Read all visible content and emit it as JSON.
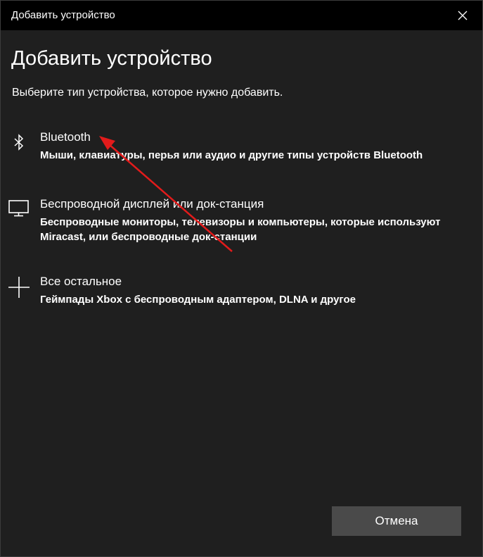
{
  "window": {
    "title": "Добавить устройство"
  },
  "main": {
    "heading": "Добавить устройство",
    "subheading": "Выберите тип устройства, которое нужно добавить.",
    "options": [
      {
        "icon": "bluetooth-icon",
        "title": "Bluetooth",
        "description": "Мыши, клавиатуры, перья или аудио и другие типы устройств Bluetooth"
      },
      {
        "icon": "monitor-icon",
        "title": "Беспроводной дисплей или док-станция",
        "description": "Беспроводные мониторы, телевизоры и компьютеры, которые используют Miracast, или беспроводные док-станции"
      },
      {
        "icon": "plus-icon",
        "title": "Все остальное",
        "description": "Геймпады Xbox с беспроводным адаптером, DLNA и другое"
      }
    ]
  },
  "footer": {
    "cancel_label": "Отмена"
  },
  "colors": {
    "background": "#1f1f1f",
    "titlebar": "#000000",
    "button": "#4a4a4a",
    "annotation_arrow": "#e21b1b"
  }
}
